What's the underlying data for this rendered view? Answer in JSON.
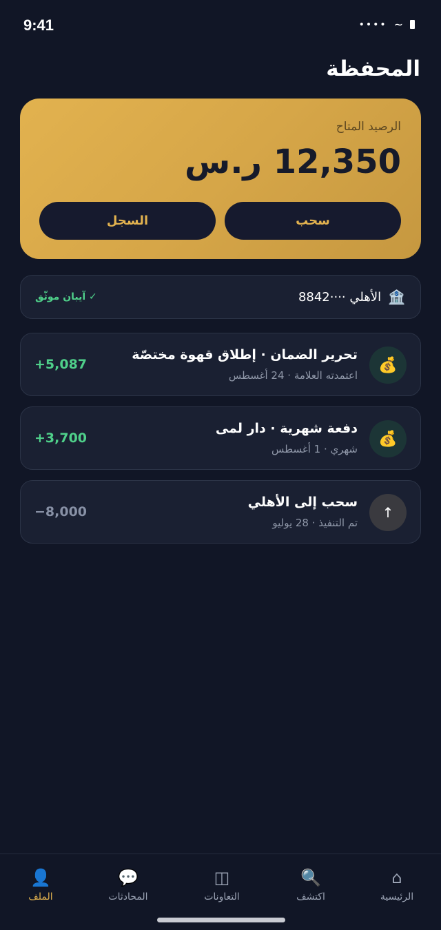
{
  "status_bar": {
    "time": "9:41",
    "signal": "••••",
    "wifi": "~",
    "icons": [
      "signal-icon",
      "wifi-icon",
      "battery-icon"
    ]
  },
  "page": {
    "title": "المحفظة"
  },
  "balance": {
    "label": "الرصيد المتاح",
    "amount": "12,350 ر.س",
    "withdraw_label": "سحب",
    "history_label": "السجل"
  },
  "bank": {
    "icon": "bank-icon",
    "icon_glyph": "🏦",
    "name": "الأهلي ····8842",
    "verified": "✓ آيبان موثّق"
  },
  "transactions": [
    {
      "icon": "money-bag-icon",
      "icon_glyph": "💰",
      "title": "تحرير الضمان · إطلاق قهوة مختصّة",
      "subtitle": "اعتمدته العلامة · 24 أغسطس",
      "amount": "+5,087",
      "kind": "positive"
    },
    {
      "icon": "money-bag-icon",
      "icon_glyph": "💰",
      "title": "دفعة شهرية · دار لمى",
      "subtitle": "شهري · 1 أغسطس",
      "amount": "+3,700",
      "kind": "positive"
    },
    {
      "icon": "arrow-up-icon",
      "icon_glyph": "↑",
      "title": "سحب إلى الأهلي",
      "subtitle": "تم التنفيذ · 28 يوليو",
      "amount": "−8,000",
      "kind": "negative"
    }
  ],
  "tabs": [
    {
      "label": "الرئيسية",
      "icon": "home-icon",
      "glyph": "⌂"
    },
    {
      "label": "اكتشف",
      "icon": "search-icon",
      "glyph": "🔍"
    },
    {
      "label": "التعاونات",
      "icon": "collabs-icon",
      "glyph": "◫"
    },
    {
      "label": "المحادثات",
      "icon": "chat-icon",
      "glyph": "💬"
    },
    {
      "label": "الملف",
      "icon": "profile-icon",
      "glyph": "👤",
      "active": true
    }
  ],
  "colors": {
    "background": "#111626",
    "accent_gold": "#e2b24f",
    "positive_green": "#4fd08a",
    "card_surface": "#1a2032"
  }
}
